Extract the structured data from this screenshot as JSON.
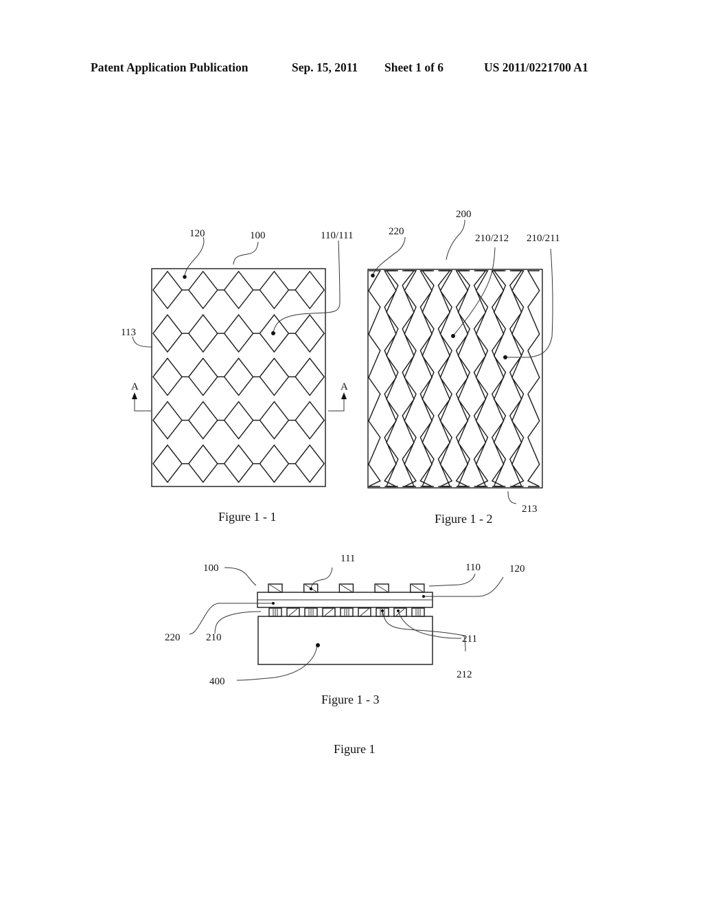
{
  "header": {
    "publication_type": "Patent Application Publication",
    "date": "Sep. 15, 2011",
    "sheet": "Sheet 1 of 6",
    "publication_number": "US 2011/0221700 A1"
  },
  "figure_1_1": {
    "caption": "Figure 1 - 1",
    "labels": {
      "substrate_layer": "120",
      "panel": "100",
      "electrode": "110/111",
      "connector": "113",
      "section_left": "A",
      "section_right": "A"
    },
    "grid": {
      "rows": 5,
      "columns": 5
    }
  },
  "figure_1_2": {
    "caption": "Figure 1 - 2",
    "labels": {
      "panel": "200",
      "substrate_layer": "220",
      "electrode_a": "210/212",
      "electrode_b": "210/211",
      "edge": "213"
    },
    "strips": {
      "primary": 5,
      "offset": 4
    }
  },
  "figure_1_3": {
    "caption": "Figure 1 - 3",
    "labels": {
      "panel": "100",
      "top_electrode_detail": "111",
      "top_electrode": "110",
      "top_layer": "120",
      "bottom_layer": "220",
      "bottom_electrodes": "210",
      "electrode_211": "211",
      "electrode_212": "212",
      "base": "400"
    },
    "top_electrode_count": 5,
    "bottom_electrode_count": 9
  },
  "figure_caption": "Figure 1"
}
